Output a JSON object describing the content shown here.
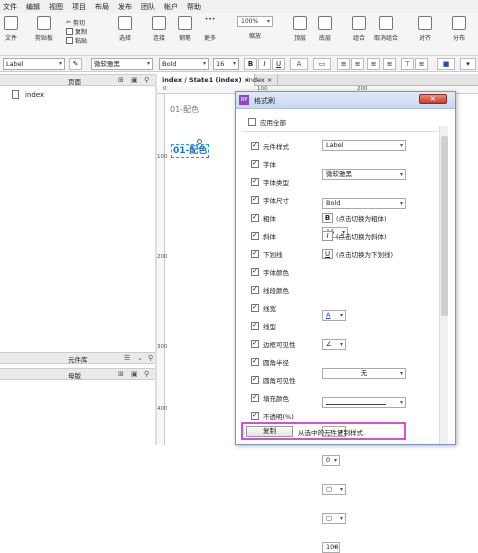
{
  "menu": [
    "文件",
    "编辑",
    "视图",
    "项目",
    "布局",
    "发布",
    "团队",
    "帐户",
    "帮助"
  ],
  "ribbon": {
    "file": "文件",
    "clipboard": "剪贴板",
    "cut": "剪切",
    "copy": "复制",
    "paste": "粘贴",
    "select": "选择",
    "connect": "连接",
    "draw": "钢笔",
    "more": "更多",
    "zoom": "100%",
    "zoom_label": "缩放",
    "top": "顶层",
    "bottom": "底层",
    "group": "组合",
    "ungroup": "取消组合",
    "align": "对齐",
    "distribute": "分布"
  },
  "format": {
    "style": "Label",
    "font": "微软雅黑",
    "weight": "Bold",
    "size": "16"
  },
  "pages": {
    "title": "页面",
    "page": "index"
  },
  "library": {
    "title": "元件库"
  },
  "master": {
    "title": "母版"
  },
  "canvas": {
    "tab1": "index / State1 (index)",
    "tab2": "index",
    "label_gray": "01-配色",
    "label_sel": "01-配色",
    "rulers": [
      "0",
      "100",
      "200"
    ],
    "vrulers": [
      "100",
      "200",
      "300",
      "400"
    ]
  },
  "dialog": {
    "title": "格式刷",
    "apply_all": "应用全部",
    "rows": [
      {
        "label": "元件样式",
        "value": "Label"
      },
      {
        "label": "字体",
        "value": "微软雅黑"
      },
      {
        "label": "字体类型",
        "value": "Bold"
      },
      {
        "label": "字体尺寸",
        "value": "16"
      },
      {
        "label": "粗体",
        "icon": "B",
        "value": "(点击切换为粗体)"
      },
      {
        "label": "斜体",
        "icon": "I",
        "value": "(点击切换为斜体)"
      },
      {
        "label": "下划线",
        "icon": "U",
        "value": "(点击切换为下划线)"
      },
      {
        "label": "字体颜色",
        "value": ""
      },
      {
        "label": "线段颜色",
        "value": ""
      },
      {
        "label": "线宽",
        "value": "无"
      },
      {
        "label": "线型",
        "value": ""
      },
      {
        "label": "边框可见性",
        "value": ""
      },
      {
        "label": "圆角半径",
        "value": "0"
      },
      {
        "label": "圆角可见性",
        "value": ""
      },
      {
        "label": "填充颜色",
        "value": ""
      },
      {
        "label": "不透明(%)",
        "value": "100"
      }
    ],
    "copy_button": "复制",
    "copy_hint": "从选中的元件复制样式."
  },
  "colors": {
    "accent": "#d44fd4",
    "selection": "#1aa0e0",
    "title_bg": "#c9d9f1"
  }
}
